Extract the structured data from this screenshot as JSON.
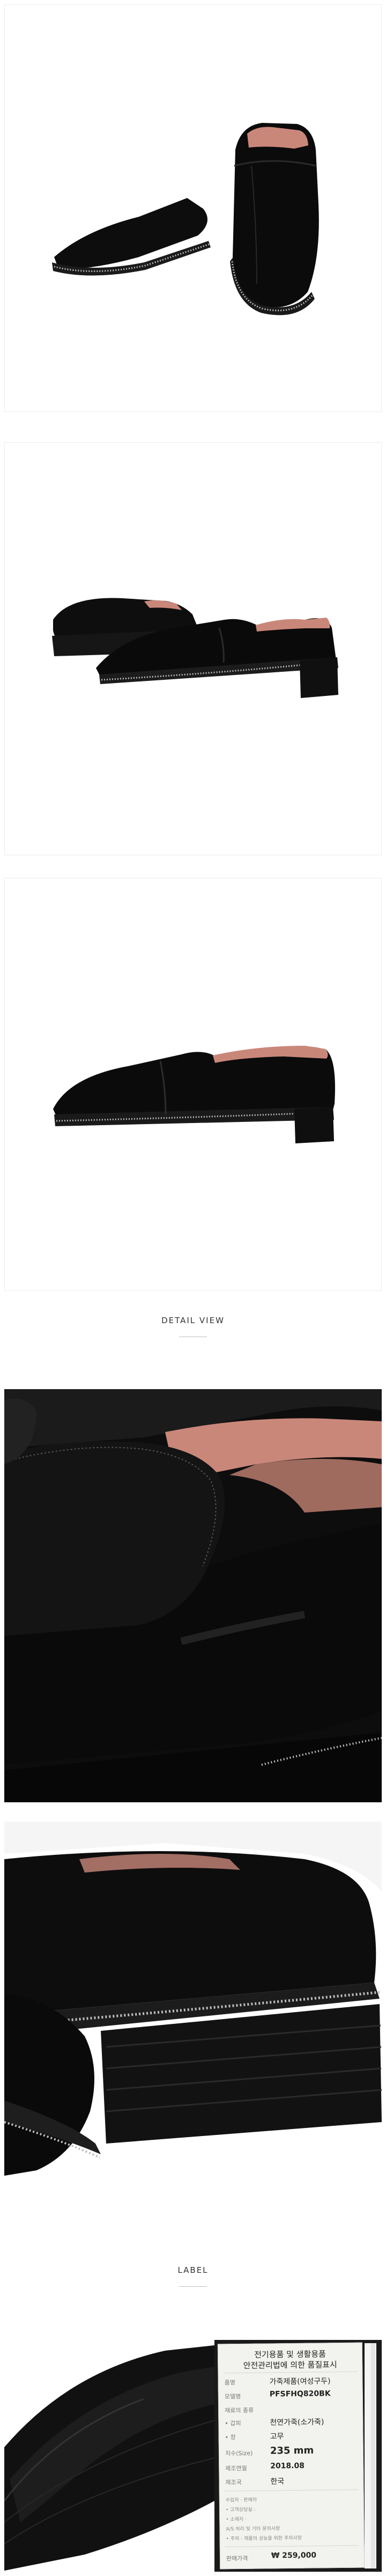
{
  "sections": {
    "detail_view": "DETAIL VIEW",
    "label": "LABEL"
  },
  "colors": {
    "leather": "#0d0d0d",
    "lining": "#c9877a",
    "stud": "#bdbdbd",
    "background": "#ffffff"
  },
  "tag": {
    "header_line1": "전기용품 및 생활용품",
    "header_line2": "안전관리법에 의한 품질표시",
    "rows": [
      {
        "label": "품명",
        "value": "가죽제품(여성구두)",
        "style": ""
      },
      {
        "label": "모델명",
        "value": "PFSFHQ820BK",
        "style": "bold"
      },
      {
        "label": "재료의 종류",
        "value": "",
        "style": ""
      },
      {
        "label": "• 갑피",
        "value": "천연가죽(소가죽)",
        "style": ""
      },
      {
        "label": "• 창",
        "value": "고무",
        "style": ""
      },
      {
        "label": "치수(Size)",
        "value": "235 mm",
        "style": "big"
      },
      {
        "label": "제조연월",
        "value": "2018.08",
        "style": "bold"
      },
      {
        "label": "제조국",
        "value": "한국",
        "style": ""
      }
    ],
    "small_lines": [
      "수입자 · 판매자",
      "• 고객상담실 :",
      "• 소재지 ·",
      "A/S 처리 및 기타 문의사항",
      "• 주의 : 제품의 성능을 위한 주의사항"
    ],
    "price_label": "판매가격",
    "price_value": "₩ 259,000"
  }
}
